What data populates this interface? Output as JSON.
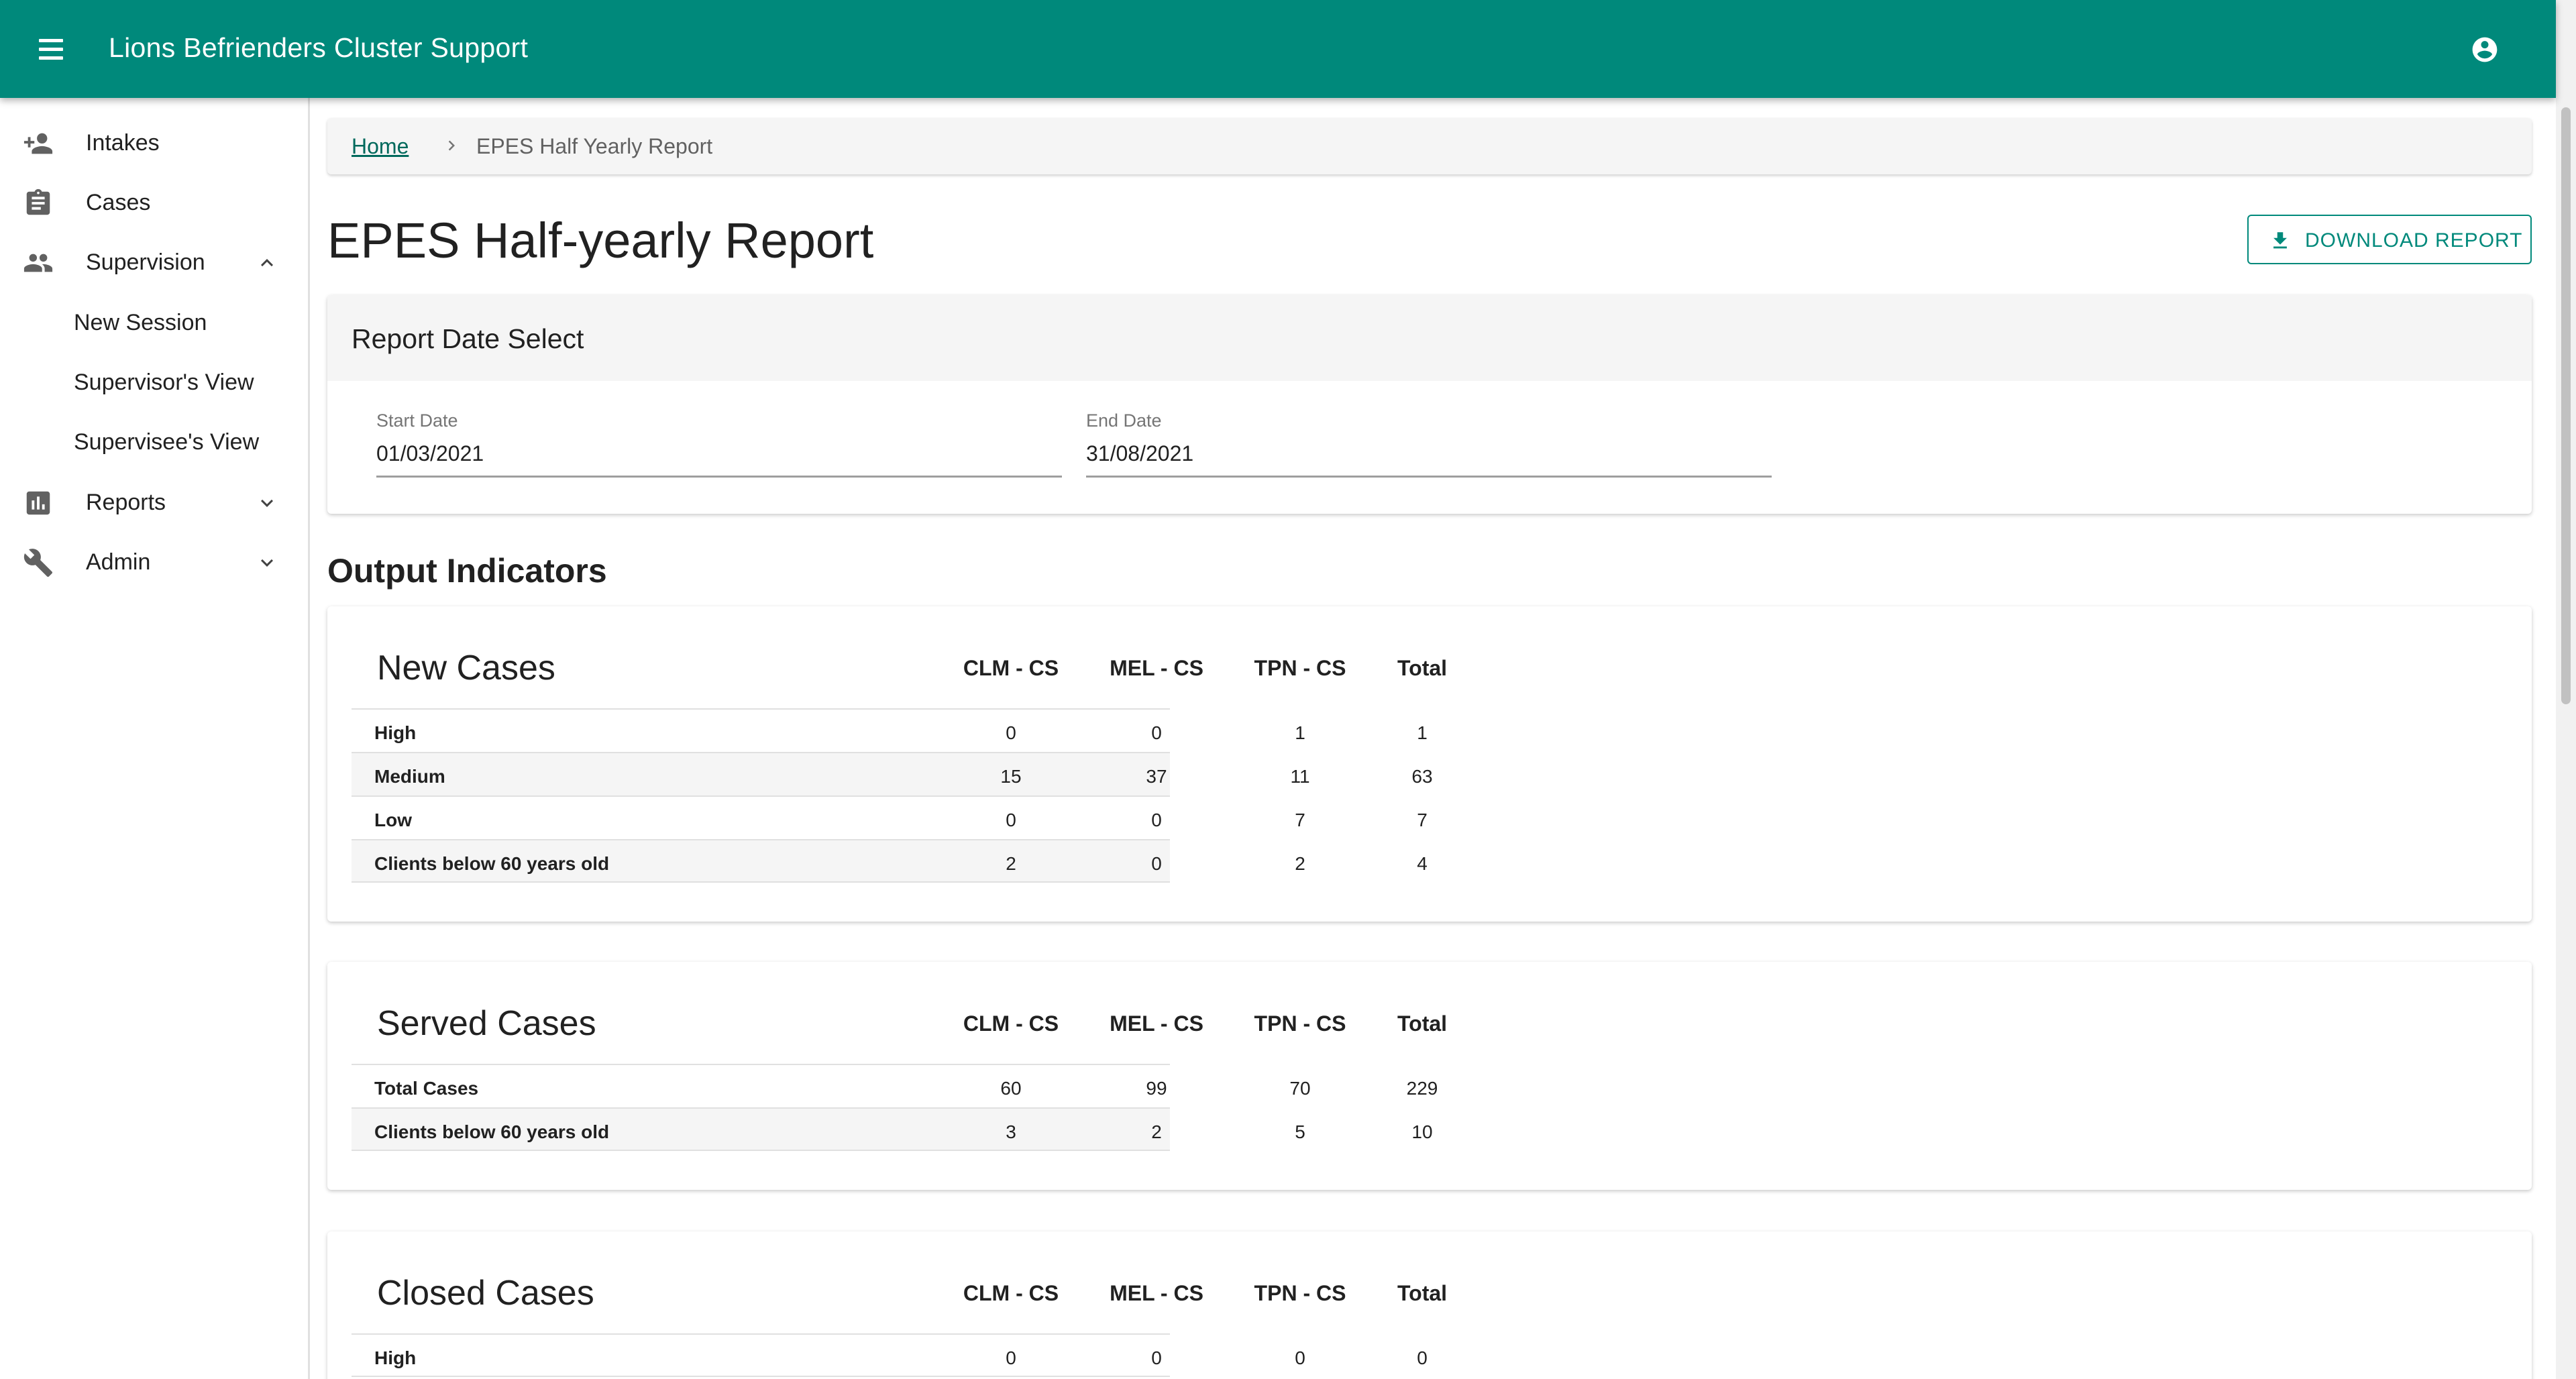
{
  "appbar": {
    "title": "Lions Befrienders Cluster Support",
    "menu_icon": "menu-icon",
    "account_icon": "account-circle-icon",
    "color": "#00897b"
  },
  "sidebar": {
    "items": [
      {
        "label": "Intakes",
        "icon": "person-add-icon"
      },
      {
        "label": "Cases",
        "icon": "clipboard-icon"
      },
      {
        "label": "Supervision",
        "icon": "people-icon",
        "expanded": true
      },
      {
        "label": "New Session"
      },
      {
        "label": "Supervisor's View"
      },
      {
        "label": "Supervisee's View"
      },
      {
        "label": "Reports",
        "icon": "bar-chart-icon",
        "expanded": false
      },
      {
        "label": "Admin",
        "icon": "wrench-icon",
        "expanded": false
      }
    ]
  },
  "breadcrumb": {
    "home": "Home",
    "current": "EPES Half Yearly Report"
  },
  "page": {
    "title": "EPES Half-yearly Report",
    "download_label": "DOWNLOAD REPORT"
  },
  "date_select": {
    "title": "Report Date Select",
    "start_label": "Start Date",
    "start_value": "01/03/2021",
    "end_label": "End Date",
    "end_value": "31/08/2021"
  },
  "output_indicators": {
    "title": "Output Indicators",
    "columns": [
      "CLM - CS",
      "MEL - CS",
      "TPN - CS",
      "Total"
    ],
    "tables": [
      {
        "title": "New Cases",
        "rows": [
          {
            "label": "High",
            "values": [
              "0",
              "0",
              "1",
              "1"
            ]
          },
          {
            "label": "Medium",
            "values": [
              "15",
              "37",
              "11",
              "63"
            ]
          },
          {
            "label": "Low",
            "values": [
              "0",
              "0",
              "7",
              "7"
            ]
          },
          {
            "label": "Clients below 60 years old",
            "values": [
              "2",
              "0",
              "2",
              "4"
            ]
          }
        ]
      },
      {
        "title": "Served Cases",
        "rows": [
          {
            "label": "Total Cases",
            "values": [
              "60",
              "99",
              "70",
              "229"
            ]
          },
          {
            "label": "Clients below 60 years old",
            "values": [
              "3",
              "2",
              "5",
              "10"
            ]
          }
        ]
      },
      {
        "title": "Closed Cases",
        "rows": [
          {
            "label": "High",
            "values": [
              "0",
              "0",
              "0",
              "0"
            ]
          }
        ]
      }
    ]
  }
}
